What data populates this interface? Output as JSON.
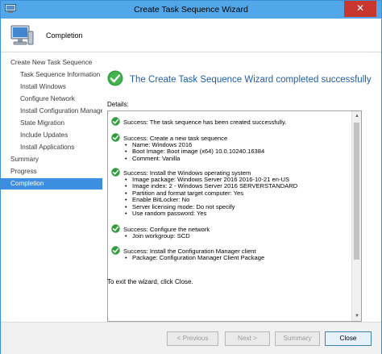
{
  "window": {
    "title": "Create Task Sequence Wizard",
    "close_glyph": "✕"
  },
  "header": {
    "page_heading": "Completion",
    "icon": "computer-icon"
  },
  "sidebar": {
    "items": [
      {
        "label": "Create New Task Sequence",
        "level": 0,
        "active": false
      },
      {
        "label": "Task Sequence Information",
        "level": 1,
        "active": false
      },
      {
        "label": "Install Windows",
        "level": 1,
        "active": false
      },
      {
        "label": "Configure Network",
        "level": 1,
        "active": false
      },
      {
        "label": "Install Configuration Manager",
        "level": 1,
        "active": false
      },
      {
        "label": "State Migration",
        "level": 1,
        "active": false
      },
      {
        "label": "Include Updates",
        "level": 1,
        "active": false
      },
      {
        "label": "Install Applications",
        "level": 1,
        "active": false
      },
      {
        "label": "Summary",
        "level": 0,
        "active": false
      },
      {
        "label": "Progress",
        "level": 0,
        "active": false
      },
      {
        "label": "Completion",
        "level": 0,
        "active": true
      }
    ]
  },
  "main": {
    "headline": "The Create Task Sequence Wizard completed successfully",
    "details_label": "Details:",
    "details": [
      {
        "status": "Success: The task sequence has been created successfully.",
        "items": []
      },
      {
        "status": "Success: Create a new task sequence",
        "items": [
          "Name: Windows 2016",
          "Boot Image: Boot image (x64) 10.0.10240.16384",
          "Comment: Vanilla"
        ]
      },
      {
        "status": "Success: Install the Windows operating system",
        "items": [
          "Image package: Windows Server 2016 2016-10-21 en-US",
          "Image index: 2 - Windows Server 2016 SERVERSTANDARD",
          "Partition and format target computer: Yes",
          "Enable BitLocker: No",
          "Server licensing mode: Do not specify",
          "Use random password: Yes"
        ]
      },
      {
        "status": "Success: Configure the network",
        "items": [
          "Join workgroup: SCD"
        ]
      },
      {
        "status": "Success: Install the Configuration Manager client",
        "items": [
          "Package: Configuration Manager Client Package"
        ]
      }
    ],
    "exit_text": "To exit the wizard, click Close."
  },
  "footer": {
    "previous_label": "< Previous",
    "next_label": "Next >",
    "summary_label": "Summary",
    "close_label": "Close"
  },
  "colors": {
    "titlebar": "#51a7e8",
    "close_button": "#c7372f",
    "headline": "#1d5fa8",
    "nav_active": "#3b8ee0",
    "success_green": "#2e9e3a"
  }
}
